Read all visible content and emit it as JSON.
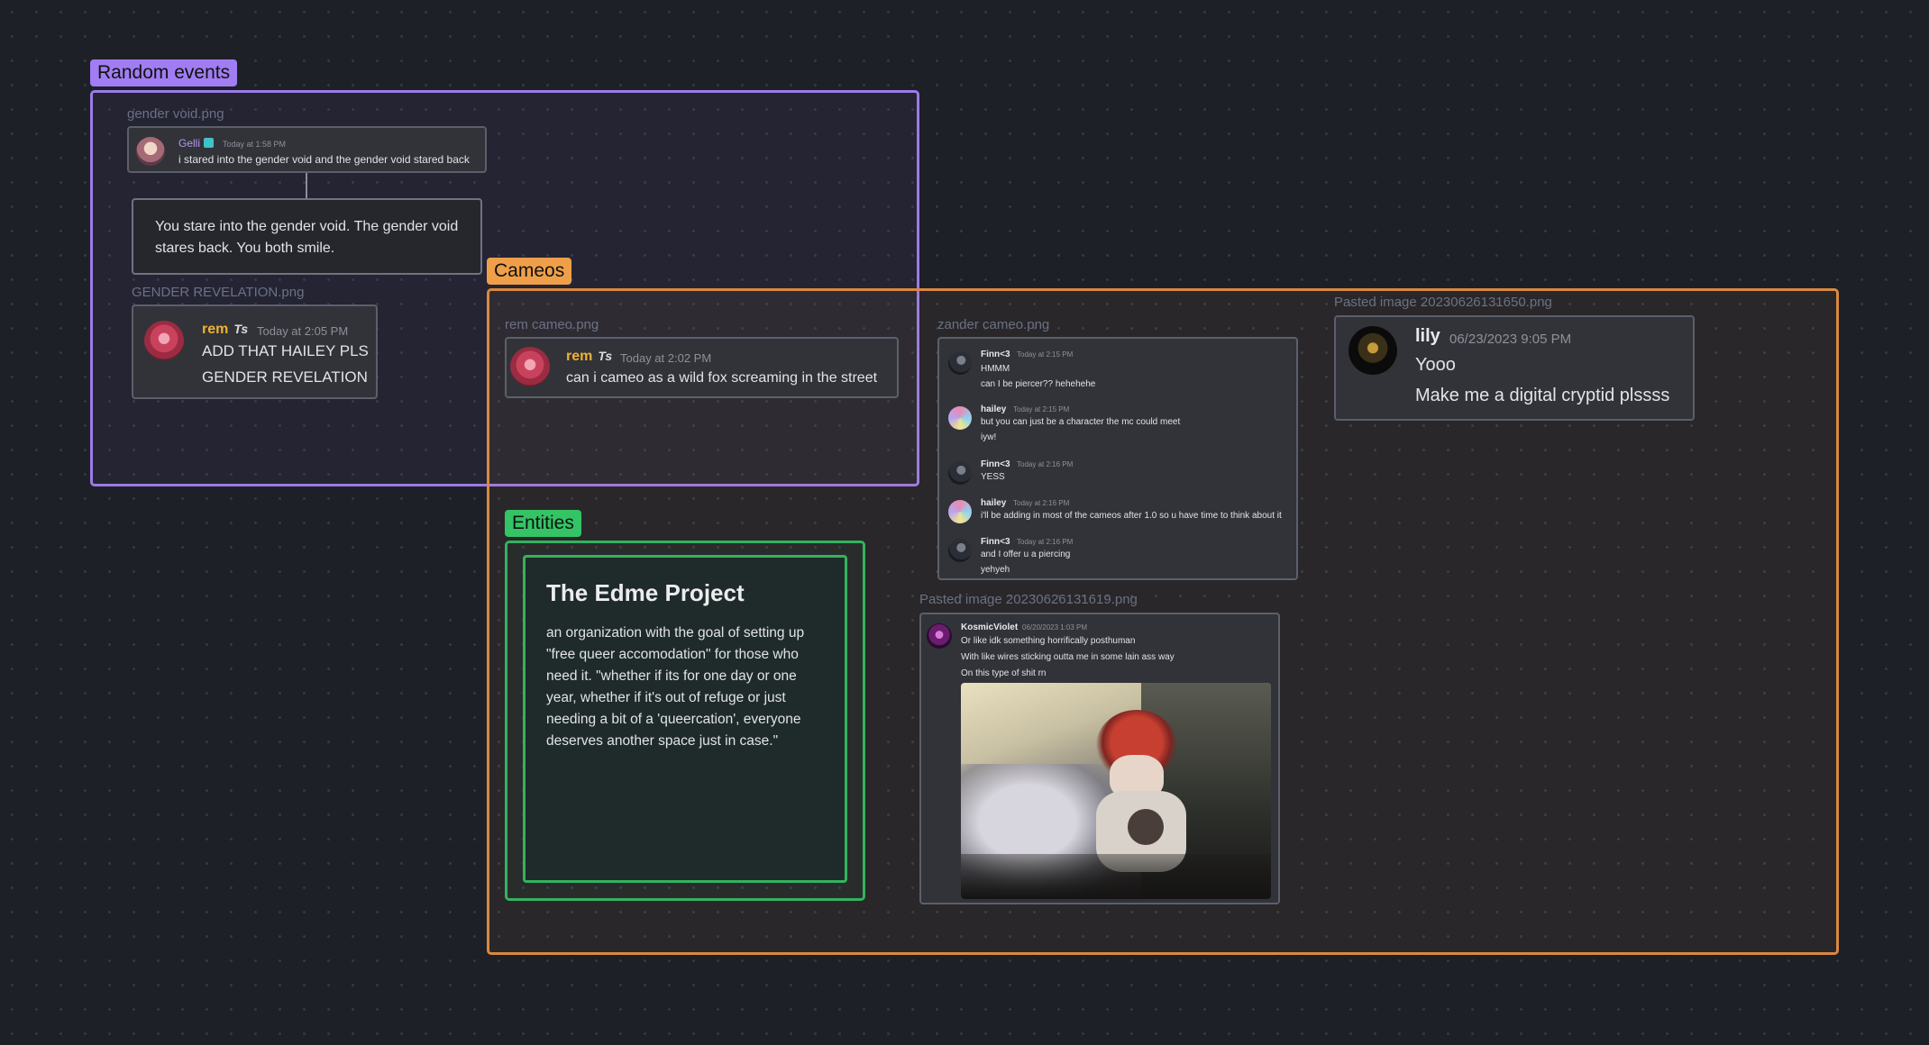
{
  "groups": {
    "random_events": {
      "label": "Random events",
      "color": "#a07df2"
    },
    "cameos": {
      "label": "Cameos",
      "color": "#ef9f4a"
    },
    "entities": {
      "label": "Entities",
      "color": "#33c466"
    }
  },
  "gender_void": {
    "file": "gender void.png",
    "user": "Gelli",
    "time": "Today at 1:58 PM",
    "text": "i stared into the gender void and the gender void stared back"
  },
  "gender_void_note": {
    "line1": "You stare into the gender void. The gender void",
    "line2": "stares back. You both smile."
  },
  "gender_revelation": {
    "file": "GENDER REVELATION.png",
    "user": "rem",
    "time": "Today at 2:05 PM",
    "line1": "ADD THAT HAILEY PLS",
    "line2": "GENDER REVELATION"
  },
  "rem_cameo": {
    "file": "rem cameo.png",
    "user": "rem",
    "time": "Today at 2:02 PM",
    "text": "can i cameo as a wild fox screaming in the street"
  },
  "zander_cameo": {
    "file": "zander cameo.png",
    "messages": [
      {
        "user": "Finn<3",
        "time": "Today at 2:15 PM",
        "lines": [
          "HMMM",
          "can I be piercer?? hehehehe"
        ]
      },
      {
        "user": "hailey",
        "time": "Today at 2:15 PM",
        "lines": [
          "but you can just be a character the mc could meet",
          "iyw!"
        ]
      },
      {
        "user": "Finn<3",
        "time": "Today at 2:16 PM",
        "lines": [
          "YESS"
        ]
      },
      {
        "user": "hailey",
        "time": "Today at 2:16 PM",
        "lines": [
          "i'll be adding in most of the cameos after 1.0 so u have time to think about it"
        ]
      },
      {
        "user": "Finn<3",
        "time": "Today at 2:16 PM",
        "lines": [
          "and I offer u a piercing",
          "yehyeh"
        ]
      }
    ]
  },
  "lily_image": {
    "file": "Pasted image 20230626131650.png",
    "user": "lily",
    "time": "06/23/2023 9:05 PM",
    "line1": "Yooo",
    "line2": "Make me a digital cryptid plssss"
  },
  "kosmic_image": {
    "file": "Pasted image 20230626131619.png",
    "user": "KosmicViolet",
    "time": "06/20/2023 1:03 PM",
    "line1": "Or like idk something horrifically posthuman",
    "line2": "With like wires sticking outta me in some lain ass way",
    "line3": "On this type of shit rn"
  },
  "edme": {
    "title": "The Edme Project",
    "lines": [
      "an organization with the goal of setting up",
      "\"free queer accomodation\" for those who",
      "need it. \"whether if its for one day or one",
      "year, whether if it's out of refuge or just",
      "needing a bit of a 'queercation', everyone",
      "deserves another space just in case.\""
    ]
  }
}
